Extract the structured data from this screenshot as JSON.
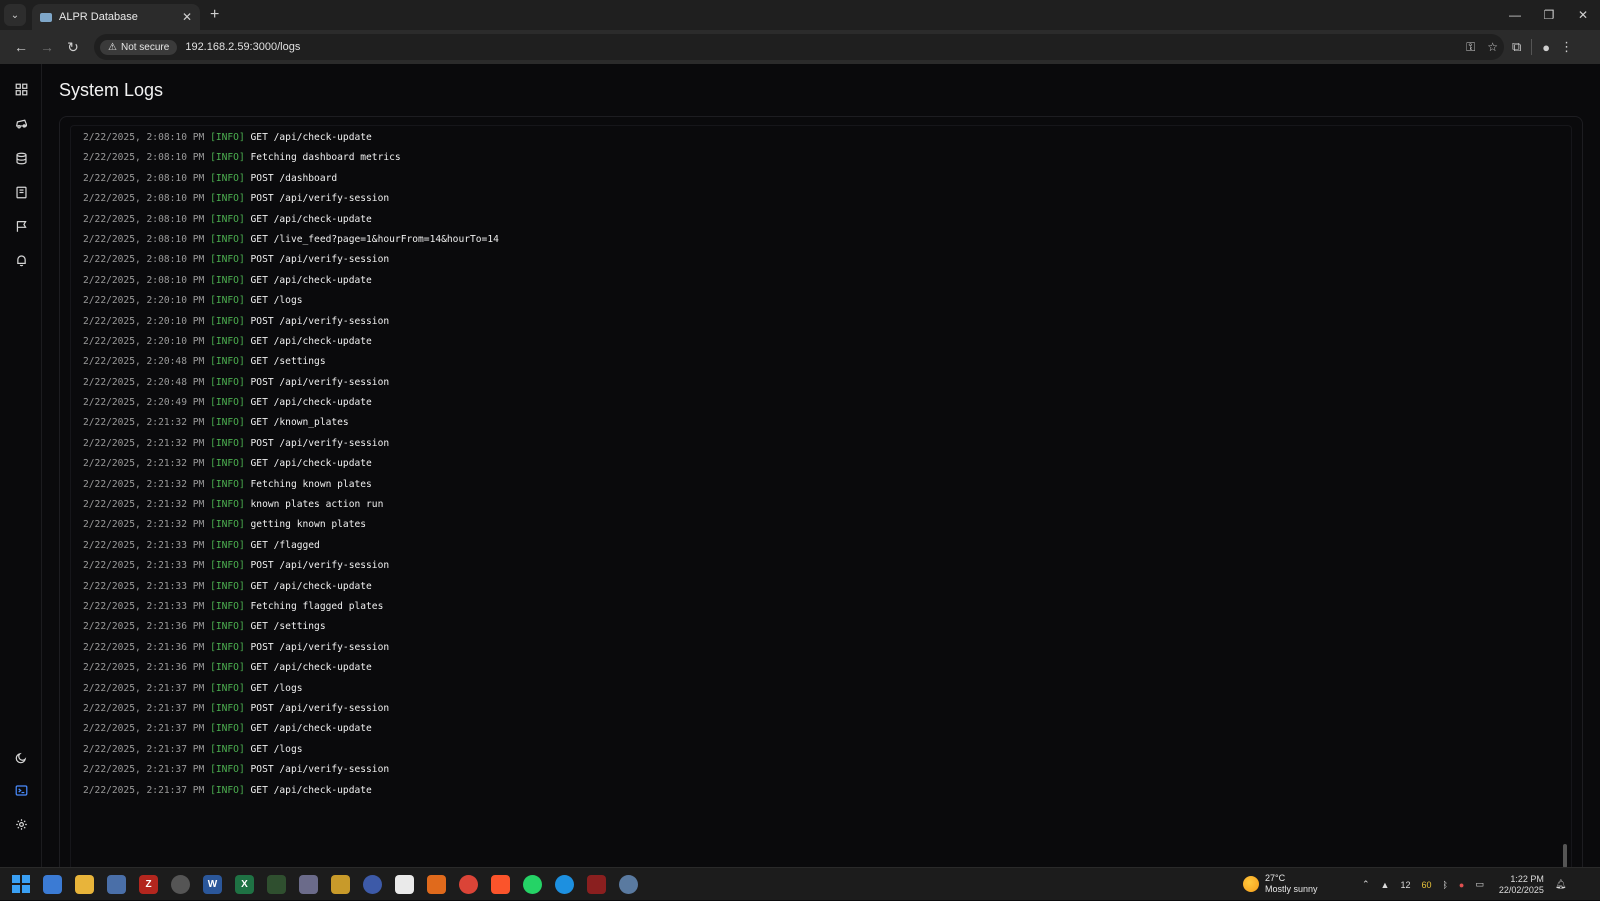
{
  "browser": {
    "tab_title": "ALPR Database",
    "tab_close": "✕",
    "new_tab": "+",
    "not_secure": "Not secure",
    "url": "192.168.2.59:3000/logs"
  },
  "page": {
    "title": "System Logs"
  },
  "sidebar": {
    "items": [
      {
        "name": "dashboard",
        "icon": "grid-icon"
      },
      {
        "name": "live-feed",
        "icon": "car-icon"
      },
      {
        "name": "database",
        "icon": "database-icon"
      },
      {
        "name": "known-plates",
        "icon": "book-icon"
      },
      {
        "name": "flagged",
        "icon": "flag-icon"
      },
      {
        "name": "notifications",
        "icon": "bell-icon"
      }
    ],
    "bottom_items": [
      {
        "name": "theme-toggle",
        "icon": "moon-icon"
      },
      {
        "name": "logs",
        "icon": "terminal-icon",
        "active": true
      },
      {
        "name": "settings",
        "icon": "gear-icon"
      }
    ],
    "active_color": "#4a8cff"
  },
  "logs": [
    {
      "ts": "2/22/2025, 2:08:10 PM",
      "level": "[INFO]",
      "msg": "GET /api/check-update"
    },
    {
      "ts": "2/22/2025, 2:08:10 PM",
      "level": "[INFO]",
      "msg": "Fetching dashboard metrics"
    },
    {
      "ts": "2/22/2025, 2:08:10 PM",
      "level": "[INFO]",
      "msg": "POST /dashboard"
    },
    {
      "ts": "2/22/2025, 2:08:10 PM",
      "level": "[INFO]",
      "msg": "POST /api/verify-session"
    },
    {
      "ts": "2/22/2025, 2:08:10 PM",
      "level": "[INFO]",
      "msg": "GET /api/check-update"
    },
    {
      "ts": "2/22/2025, 2:08:10 PM",
      "level": "[INFO]",
      "msg": "GET /live_feed?page=1&hourFrom=14&hourTo=14"
    },
    {
      "ts": "2/22/2025, 2:08:10 PM",
      "level": "[INFO]",
      "msg": "POST /api/verify-session"
    },
    {
      "ts": "2/22/2025, 2:08:10 PM",
      "level": "[INFO]",
      "msg": "GET /api/check-update"
    },
    {
      "ts": "2/22/2025, 2:20:10 PM",
      "level": "[INFO]",
      "msg": "GET /logs"
    },
    {
      "ts": "2/22/2025, 2:20:10 PM",
      "level": "[INFO]",
      "msg": "POST /api/verify-session"
    },
    {
      "ts": "2/22/2025, 2:20:10 PM",
      "level": "[INFO]",
      "msg": "GET /api/check-update"
    },
    {
      "ts": "2/22/2025, 2:20:48 PM",
      "level": "[INFO]",
      "msg": "GET /settings"
    },
    {
      "ts": "2/22/2025, 2:20:48 PM",
      "level": "[INFO]",
      "msg": "POST /api/verify-session"
    },
    {
      "ts": "2/22/2025, 2:20:49 PM",
      "level": "[INFO]",
      "msg": "GET /api/check-update"
    },
    {
      "ts": "2/22/2025, 2:21:32 PM",
      "level": "[INFO]",
      "msg": "GET /known_plates"
    },
    {
      "ts": "2/22/2025, 2:21:32 PM",
      "level": "[INFO]",
      "msg": "POST /api/verify-session"
    },
    {
      "ts": "2/22/2025, 2:21:32 PM",
      "level": "[INFO]",
      "msg": "GET /api/check-update"
    },
    {
      "ts": "2/22/2025, 2:21:32 PM",
      "level": "[INFO]",
      "msg": "Fetching known plates"
    },
    {
      "ts": "2/22/2025, 2:21:32 PM",
      "level": "[INFO]",
      "msg": "known plates action run"
    },
    {
      "ts": "2/22/2025, 2:21:32 PM",
      "level": "[INFO]",
      "msg": "getting known plates"
    },
    {
      "ts": "2/22/2025, 2:21:33 PM",
      "level": "[INFO]",
      "msg": "GET /flagged"
    },
    {
      "ts": "2/22/2025, 2:21:33 PM",
      "level": "[INFO]",
      "msg": "POST /api/verify-session"
    },
    {
      "ts": "2/22/2025, 2:21:33 PM",
      "level": "[INFO]",
      "msg": "GET /api/check-update"
    },
    {
      "ts": "2/22/2025, 2:21:33 PM",
      "level": "[INFO]",
      "msg": "Fetching flagged plates"
    },
    {
      "ts": "2/22/2025, 2:21:36 PM",
      "level": "[INFO]",
      "msg": "GET /settings"
    },
    {
      "ts": "2/22/2025, 2:21:36 PM",
      "level": "[INFO]",
      "msg": "POST /api/verify-session"
    },
    {
      "ts": "2/22/2025, 2:21:36 PM",
      "level": "[INFO]",
      "msg": "GET /api/check-update"
    },
    {
      "ts": "2/22/2025, 2:21:37 PM",
      "level": "[INFO]",
      "msg": "GET /logs"
    },
    {
      "ts": "2/22/2025, 2:21:37 PM",
      "level": "[INFO]",
      "msg": "POST /api/verify-session"
    },
    {
      "ts": "2/22/2025, 2:21:37 PM",
      "level": "[INFO]",
      "msg": "GET /api/check-update"
    },
    {
      "ts": "2/22/2025, 2:21:37 PM",
      "level": "[INFO]",
      "msg": "GET /logs"
    },
    {
      "ts": "2/22/2025, 2:21:37 PM",
      "level": "[INFO]",
      "msg": "POST /api/verify-session"
    },
    {
      "ts": "2/22/2025, 2:21:37 PM",
      "level": "[INFO]",
      "msg": "GET /api/check-update"
    }
  ],
  "taskbar": {
    "weather_temp": "27°C",
    "weather_desc": "Mostly sunny",
    "tray_num1": "12",
    "tray_num2": "60",
    "time": "1:22 PM",
    "date": "22/02/2025"
  }
}
